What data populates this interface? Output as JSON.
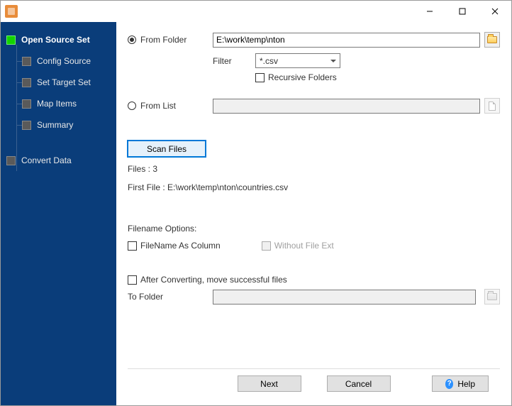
{
  "titlebar": {
    "title": ""
  },
  "sidebar": {
    "items": [
      {
        "label": "Open Source Set",
        "active": true,
        "level": 0
      },
      {
        "label": "Config Source",
        "active": false,
        "level": 1
      },
      {
        "label": "Set Target Set",
        "active": false,
        "level": 1
      },
      {
        "label": "Map Items",
        "active": false,
        "level": 1
      },
      {
        "label": "Summary",
        "active": false,
        "level": 1
      },
      {
        "label": "Convert Data",
        "active": false,
        "level": 0
      }
    ]
  },
  "main": {
    "from_folder": {
      "radio_label": "From Folder",
      "path_value": "E:\\work\\temp\\nton",
      "filter_label": "Filter",
      "filter_value": "*.csv",
      "recursive_label": "Recursive Folders",
      "recursive_checked": false
    },
    "from_list": {
      "radio_label": "From List",
      "path_value": ""
    },
    "scan": {
      "button_label": "Scan Files",
      "files_count_label": "Files : 3",
      "first_file_label": "First File : E:\\work\\temp\\nton\\countries.csv"
    },
    "filename_options": {
      "heading": "Filename Options:",
      "as_column_label": "FileName As Column",
      "as_column_checked": false,
      "without_ext_label": "Without File Ext",
      "without_ext_checked": false,
      "without_ext_disabled": true
    },
    "after_convert": {
      "move_label": "After Converting, move successful files",
      "move_checked": false,
      "to_folder_label": "To Folder",
      "to_folder_value": ""
    }
  },
  "footer": {
    "next_label": "Next",
    "cancel_label": "Cancel",
    "help_label": "Help"
  }
}
